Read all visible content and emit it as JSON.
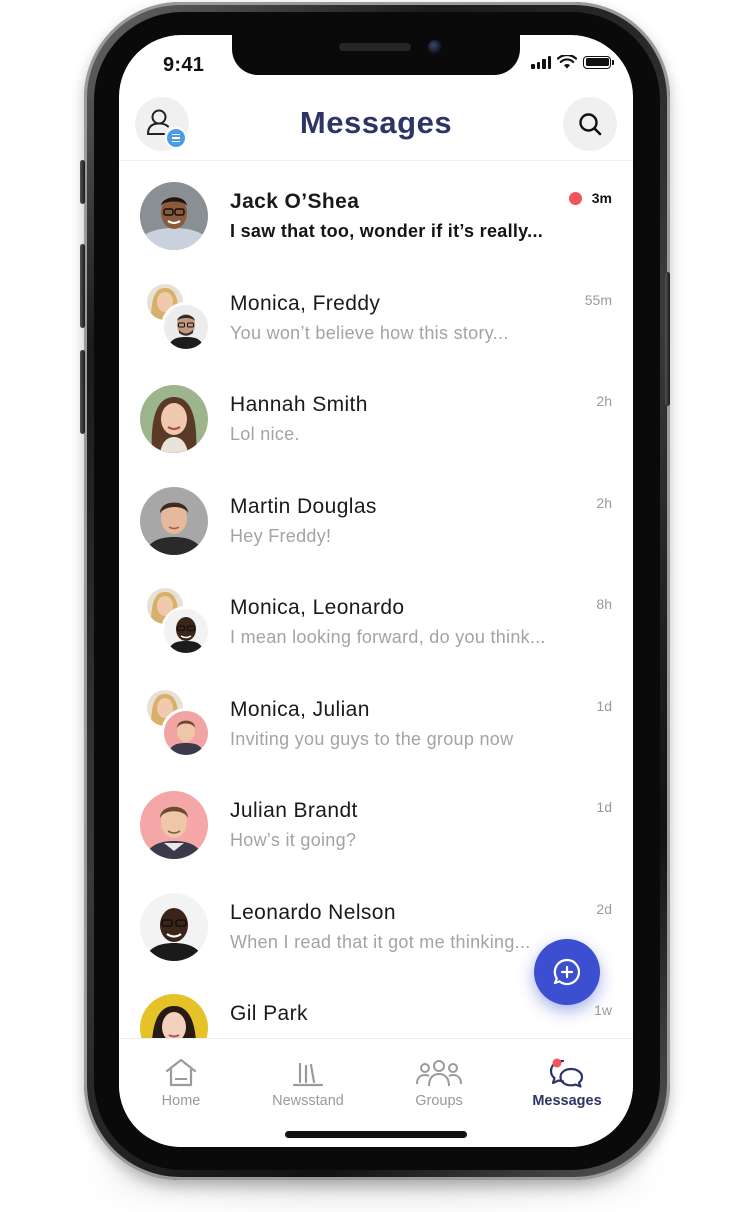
{
  "status_bar": {
    "time": "9:41",
    "icons": [
      "cellular-signal-icon",
      "wifi-icon",
      "battery-icon"
    ]
  },
  "header": {
    "title": "Messages",
    "left_icon": "profile-menu-icon",
    "right_icon": "search-icon"
  },
  "colors": {
    "title": "#2e3566",
    "accent": "#3c4fd1",
    "unread_dot": "#f0555a",
    "badge": "#4a9ce8"
  },
  "conversations": [
    {
      "name": "Jack O’Shea",
      "preview": "I saw that too, wonder if it’s really...",
      "time": "3m",
      "unread": true
    },
    {
      "name": "Monica, Freddy",
      "preview": "You won’t believe how this story...",
      "time": "55m",
      "unread": false
    },
    {
      "name": "Hannah Smith",
      "preview": "Lol nice.",
      "time": "2h",
      "unread": false
    },
    {
      "name": "Martin Douglas",
      "preview": "Hey Freddy!",
      "time": "2h",
      "unread": false
    },
    {
      "name": "Monica, Leonardo",
      "preview": "I mean looking forward, do you think...",
      "time": "8h",
      "unread": false
    },
    {
      "name": "Monica, Julian",
      "preview": "Inviting you guys to the group now",
      "time": "1d",
      "unread": false
    },
    {
      "name": "Julian Brandt",
      "preview": "How’s it going?",
      "time": "1d",
      "unread": false
    },
    {
      "name": "Leonardo Nelson",
      "preview": "When I read that it got me thinking...",
      "time": "2d",
      "unread": false
    },
    {
      "name": "Gil Park",
      "preview": "",
      "time": "1w",
      "unread": false
    }
  ],
  "fab": {
    "icon": "new-message-icon"
  },
  "tabbar": {
    "tabs": [
      {
        "label": "Home",
        "icon": "home-icon",
        "active": false
      },
      {
        "label": "Newsstand",
        "icon": "newsstand-icon",
        "active": false
      },
      {
        "label": "Groups",
        "icon": "groups-icon",
        "active": false
      },
      {
        "label": "Messages",
        "icon": "messages-icon",
        "active": true
      }
    ]
  }
}
